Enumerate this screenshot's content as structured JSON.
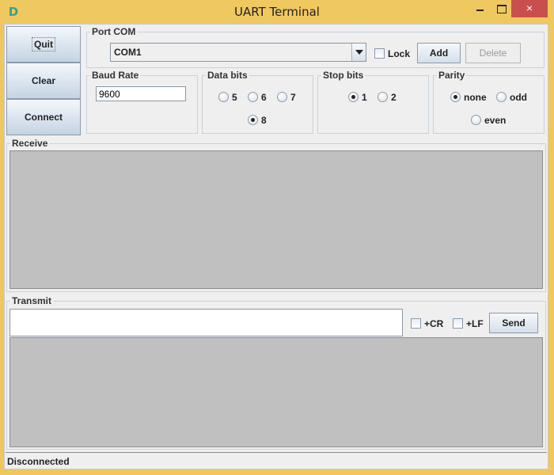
{
  "window": {
    "title": "UART Terminal",
    "icon": "app-logo-icon",
    "controls": {
      "minimize": "minimize",
      "maximize": "maximize",
      "close": "×"
    }
  },
  "sidebar": {
    "quit_label": "Quit",
    "clear_label": "Clear",
    "connect_label": "Connect"
  },
  "port": {
    "legend": "Port COM",
    "selected": "COM1",
    "lock_label": "Lock",
    "lock_checked": false,
    "add_label": "Add",
    "delete_label": "Delete"
  },
  "baud": {
    "legend": "Baud Rate",
    "value": "9600"
  },
  "data_bits": {
    "legend": "Data bits",
    "options": [
      "5",
      "6",
      "7",
      "8"
    ],
    "selected": "8"
  },
  "stop_bits": {
    "legend": "Stop bits",
    "options": [
      "1",
      "2"
    ],
    "selected": "1"
  },
  "parity": {
    "legend": "Parity",
    "options": [
      "none",
      "odd",
      "even"
    ],
    "selected": "none"
  },
  "receive": {
    "legend": "Receive",
    "content": ""
  },
  "transmit": {
    "legend": "Transmit",
    "input_value": "",
    "cr_label": "+CR",
    "cr_checked": false,
    "lf_label": "+LF",
    "lf_checked": false,
    "send_label": "Send",
    "log_content": ""
  },
  "status": {
    "text": "Disconnected"
  }
}
